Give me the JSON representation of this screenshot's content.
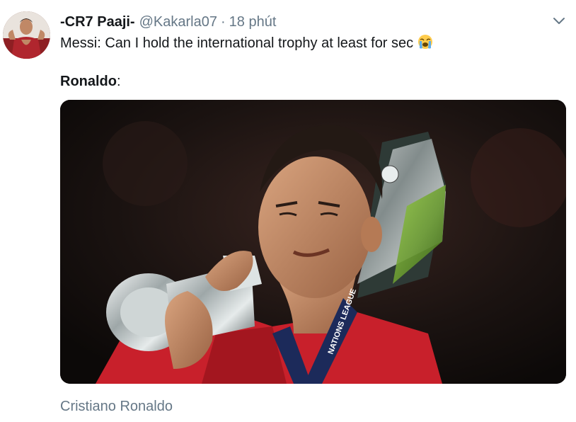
{
  "tweet": {
    "display_name": "-CR7 Paaji-",
    "handle": "@Kakarla07",
    "separator": "·",
    "time": "18 phút",
    "line1": "Messi: Can I hold the international trophy at least for sec",
    "line2_bold": "Ronaldo",
    "line2_rest": ":",
    "emoji": "loudly-crying-face-icon",
    "media_tag": "Cristiano Ronaldo"
  },
  "photo": {
    "medal_ribbon_text": "NATIONS LEAGUE"
  },
  "colors": {
    "text": "#14171a",
    "secondary": "#657786",
    "jersey": "#c8202b",
    "ribbon": "#1c2a5a"
  }
}
